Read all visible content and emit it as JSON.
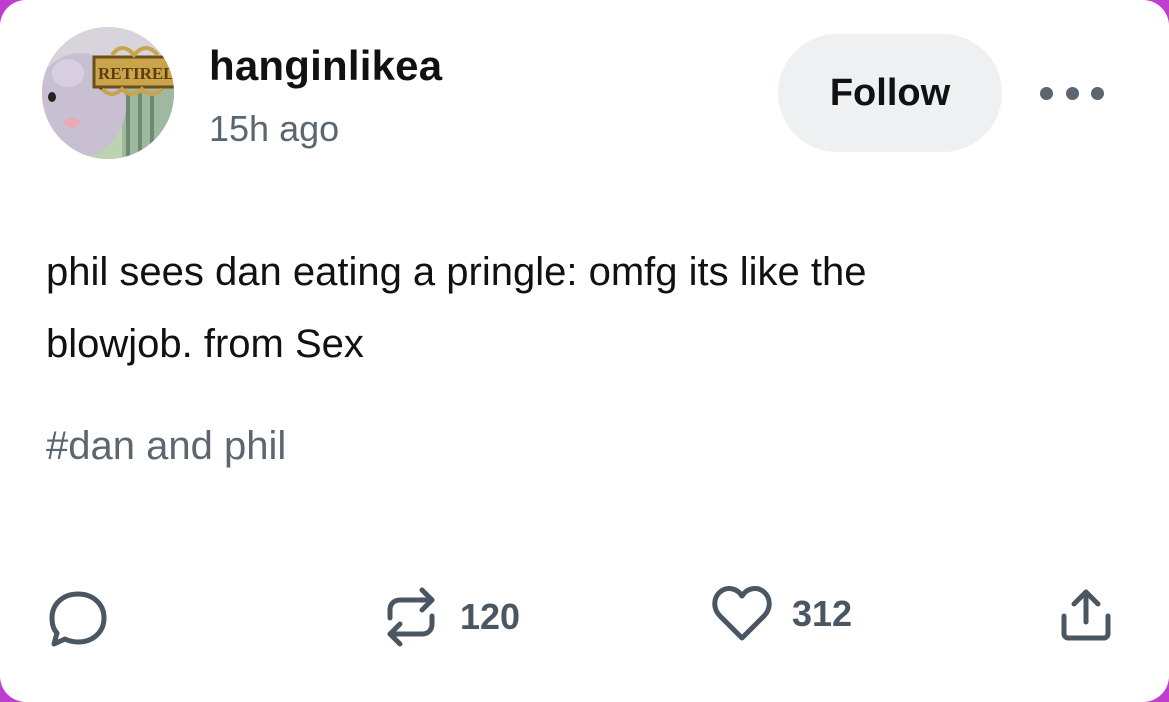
{
  "post": {
    "avatar": {
      "icon": "avatar-retired-sign",
      "sign_text": "RETIREL"
    },
    "username": "hanginlikea",
    "timestamp": "15h ago",
    "follow_label": "Follow",
    "more_icon": "ellipsis-icon",
    "body_lines": [
      "phil sees dan eating a pringle: omfg its like the",
      "blowjob. from Sex"
    ],
    "tag": "#dan and phil",
    "actions": {
      "comment": {
        "icon": "comment-icon"
      },
      "reblog": {
        "icon": "reblog-icon",
        "count": "120"
      },
      "like": {
        "icon": "heart-icon",
        "count": "312"
      },
      "share": {
        "icon": "share-icon"
      }
    }
  },
  "colors": {
    "frame": "#c03ecf",
    "card": "#ffffff",
    "text": "#111111",
    "muted": "#5b6670",
    "button_bg": "#eef0f2",
    "icon": "#4a5662"
  }
}
